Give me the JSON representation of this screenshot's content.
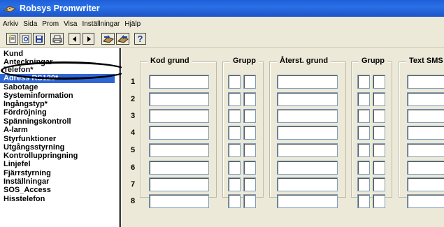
{
  "window": {
    "title": "Robsys Promwriter"
  },
  "menu": [
    "Arkiv",
    "Sida",
    "Prom",
    "Visa",
    "Inställningar",
    "Hjälp"
  ],
  "toolbar": {
    "buttons": [
      "new-icon",
      "preview-icon",
      "save-icon",
      "print-icon",
      "prev-icon",
      "next-icon",
      "transfer-icon",
      "receive-icon",
      "help-icon"
    ],
    "help_label": "?"
  },
  "sidebar": {
    "items": [
      "Kund",
      "Anteckningar",
      "Telefon*",
      "Adress RS120*",
      "Sabotage",
      "Systeminformation",
      "Ingångstyp*",
      "Fördröjning",
      "Spänningskontroll",
      "A-larm",
      "Styrfunktioner",
      "Utgångsstyrning",
      "Kontrolluppringning",
      "Linjefel",
      "Fjärrstyrning",
      "Inställningar",
      "SOS_Access",
      "Hisstelefon"
    ],
    "selected": "Adress RS120*"
  },
  "form": {
    "groups": {
      "kod_grund": "Kod grund",
      "grupp1": "Grupp",
      "aterst_grund": "Återst. grund",
      "grupp2": "Grupp",
      "text_sms": "Text SMS"
    },
    "rows": [
      "1",
      "2",
      "3",
      "4",
      "5",
      "6",
      "7",
      "8"
    ]
  }
}
